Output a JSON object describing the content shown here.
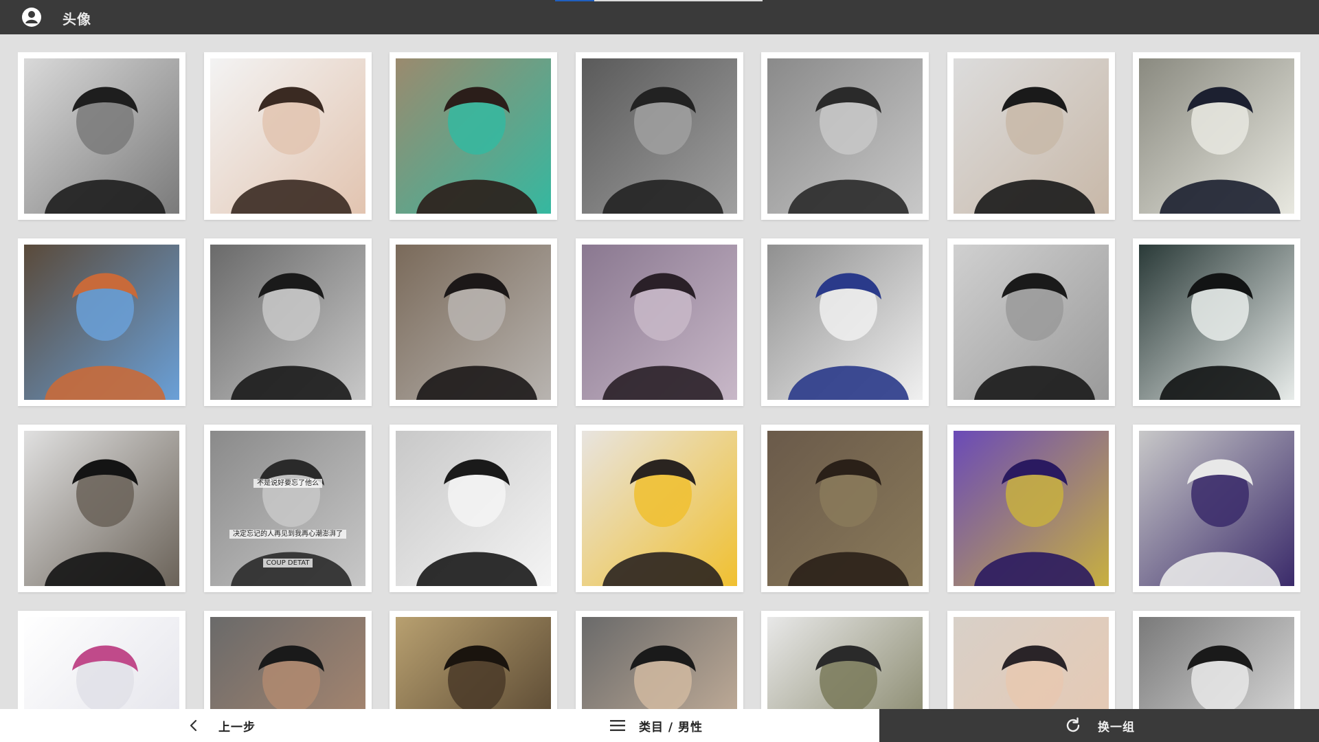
{
  "header": {
    "title": "头像",
    "avatar_icon": "account-circle-icon",
    "progress": 0.19,
    "progress_color": "#1f5fbf"
  },
  "tiles": [
    {
      "palette": [
        "#d9d9d9",
        "#7a7a7a",
        "#1e1e1e"
      ],
      "caption_top": "",
      "caption_mid": "",
      "caption_bottom": ""
    },
    {
      "palette": [
        "#f3f3f3",
        "#e2c4b0",
        "#3a2a22"
      ],
      "caption_top": "",
      "caption_mid": "",
      "caption_bottom": ""
    },
    {
      "palette": [
        "#9b8a6e",
        "#35b8a0",
        "#2b1e1a"
      ],
      "caption_top": "",
      "caption_mid": "",
      "caption_bottom": ""
    },
    {
      "palette": [
        "#5a5a5a",
        "#a0a0a0",
        "#222222"
      ],
      "caption_top": "",
      "caption_mid": "",
      "caption_bottom": ""
    },
    {
      "palette": [
        "#8a8a8a",
        "#c8c8c8",
        "#2a2a2a"
      ],
      "caption_top": "",
      "caption_mid": "",
      "caption_bottom": ""
    },
    {
      "palette": [
        "#dcdcdc",
        "#c8b8a8",
        "#1a1a1a"
      ],
      "caption_top": "",
      "caption_mid": "",
      "caption_bottom": ""
    },
    {
      "palette": [
        "#8a8a80",
        "#e8e8e0",
        "#1c2030"
      ],
      "caption_top": "",
      "caption_mid": "",
      "caption_bottom": ""
    },
    {
      "palette": [
        "#5a4a3a",
        "#6aa0d8",
        "#c86a3a"
      ],
      "caption_top": "",
      "caption_mid": "",
      "caption_bottom": ""
    },
    {
      "palette": [
        "#6a6a6a",
        "#c8c8c8",
        "#1a1a1a"
      ],
      "caption_top": "",
      "caption_mid": "",
      "caption_bottom": ""
    },
    {
      "palette": [
        "#7a6a5a",
        "#b8b4b0",
        "#1c1818"
      ],
      "caption_top": "",
      "caption_mid": "",
      "caption_bottom": ""
    },
    {
      "palette": [
        "#8a7890",
        "#c8b8c8",
        "#2a2028"
      ],
      "caption_top": "",
      "caption_mid": "",
      "caption_bottom": ""
    },
    {
      "palette": [
        "#909090",
        "#f0f0f0",
        "#2a3a8a"
      ],
      "caption_top": "",
      "caption_mid": "",
      "caption_bottom": ""
    },
    {
      "palette": [
        "#d0d0d0",
        "#9a9a9a",
        "#1a1a1a"
      ],
      "caption_top": "",
      "caption_mid": "",
      "caption_bottom": ""
    },
    {
      "palette": [
        "#2a3a38",
        "#e8ecea",
        "#121414"
      ],
      "caption_top": "",
      "caption_mid": "",
      "caption_bottom": ""
    },
    {
      "palette": [
        "#e0e0e0",
        "#6a6258",
        "#141414"
      ],
      "caption_top": "",
      "caption_mid": "",
      "caption_bottom": ""
    },
    {
      "palette": [
        "#8a8a8a",
        "#c8c8c8",
        "#2a2a2a"
      ],
      "caption_top": "不是说好要忘了他么",
      "caption_mid": "决定忘记的人再见到我再心潮澎湃了",
      "caption_bottom": "COUP DETAT"
    },
    {
      "palette": [
        "#c8c8c8",
        "#f4f4f4",
        "#1a1a1a"
      ],
      "caption_top": "",
      "caption_mid": "",
      "caption_bottom": ""
    },
    {
      "palette": [
        "#e8e4e0",
        "#f0c030",
        "#2a2420"
      ],
      "caption_top": "",
      "caption_mid": "",
      "caption_bottom": ""
    },
    {
      "palette": [
        "#6a5a4a",
        "#8a7a5a",
        "#2a2018"
      ],
      "caption_top": "",
      "caption_mid": "",
      "caption_bottom": ""
    },
    {
      "palette": [
        "#6a4ab8",
        "#c8b040",
        "#2a1a60"
      ],
      "caption_top": "",
      "caption_mid": "",
      "caption_bottom": ""
    },
    {
      "palette": [
        "#c8c8c8",
        "#3a2a6a",
        "#e8e8e8"
      ],
      "caption_top": "",
      "caption_mid": "",
      "caption_bottom": ""
    },
    {
      "palette": [
        "#ffffff",
        "#e0e0e8",
        "#c04a8a"
      ],
      "caption_top": "",
      "caption_mid": "",
      "caption_bottom": ""
    },
    {
      "palette": [
        "#6a6a6a",
        "#b08a70",
        "#1a1a1a"
      ],
      "caption_top": "",
      "caption_mid": "",
      "caption_bottom": ""
    },
    {
      "palette": [
        "#b8a070",
        "#4a3a28",
        "#1a140e"
      ],
      "caption_top": "",
      "caption_mid": "",
      "caption_bottom": ""
    },
    {
      "palette": [
        "#6a6a6a",
        "#d0b8a0",
        "#1a1a1a"
      ],
      "caption_top": "",
      "caption_mid": "",
      "caption_bottom": ""
    },
    {
      "palette": [
        "#e8e8e8",
        "#7a7a5a",
        "#2a2a2a"
      ],
      "caption_top": "",
      "caption_mid": "",
      "caption_bottom": ""
    },
    {
      "palette": [
        "#d8d0c8",
        "#e8c8b0",
        "#2a2428"
      ],
      "caption_top": "",
      "caption_mid": "",
      "caption_bottom": ""
    },
    {
      "palette": [
        "#7a7a7a",
        "#e8e8e8",
        "#1a1a1a"
      ],
      "caption_top": "",
      "caption_mid": "",
      "caption_bottom": ""
    }
  ],
  "footer": {
    "prev_label": "上一步",
    "prev_icon": "chevron-left-icon",
    "category_label": "类目 / 男性",
    "category_icon": "menu-icon",
    "swap_label": "换一组",
    "swap_icon": "refresh-icon",
    "swap_bg": "#3a3a3a"
  }
}
